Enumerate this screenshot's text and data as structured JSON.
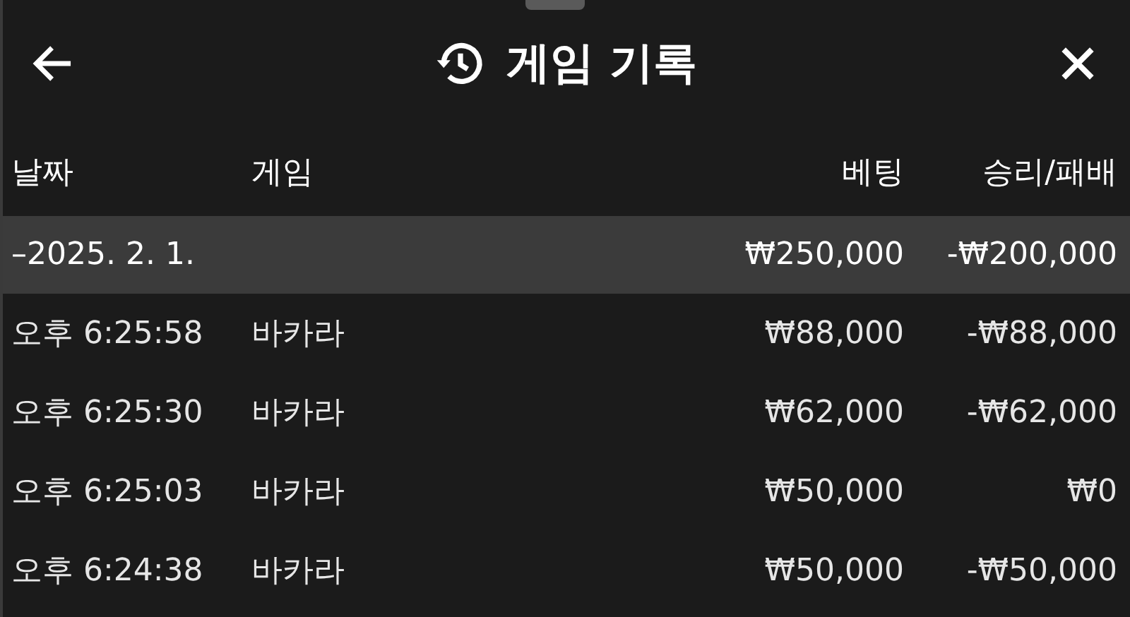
{
  "header": {
    "title": "게임 기록"
  },
  "columns": [
    "날짜",
    "게임",
    "베팅",
    "승리/패배"
  ],
  "groups": [
    {
      "date": "–2025. 2. 1.",
      "bet": "₩250,000",
      "result": "-₩200,000",
      "rows": [
        {
          "time": "오후 6:25:58",
          "game": "바카라",
          "bet": "₩88,000",
          "result": "-₩88,000"
        },
        {
          "time": "오후 6:25:30",
          "game": "바카라",
          "bet": "₩62,000",
          "result": "-₩62,000"
        },
        {
          "time": "오후 6:25:03",
          "game": "바카라",
          "bet": "₩50,000",
          "result": "₩0"
        },
        {
          "time": "오후 6:24:38",
          "game": "바카라",
          "bet": "₩50,000",
          "result": "-₩50,000"
        }
      ]
    }
  ]
}
